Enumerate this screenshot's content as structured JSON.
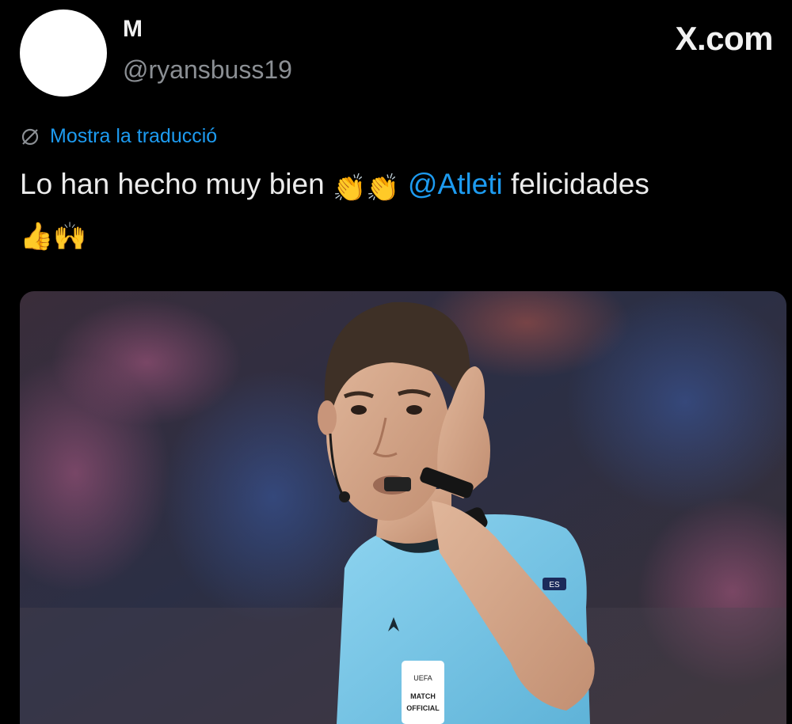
{
  "tweet": {
    "display_name": "M",
    "handle": "@ryansbuss19",
    "brand": "X.com",
    "translate_label": "Mostra la traducció",
    "text_part1": "Lo han hecho muy bien",
    "emoji_clap": "👏",
    "mention": "@Atleti",
    "text_part2": "felicidades",
    "emoji_thumbs": "👍",
    "emoji_raised_hands": "🙌"
  },
  "media": {
    "badge_line1": "UEFA",
    "badge_line2": "MATCH",
    "badge_line3": "OFFICIAL",
    "sleeve_text": "ES"
  },
  "colors": {
    "background": "#000000",
    "link": "#1d9bf0",
    "handle": "#8b8f94",
    "jersey": "#7ec8e8"
  },
  "icons": {
    "translate": "globe-slash-icon"
  }
}
